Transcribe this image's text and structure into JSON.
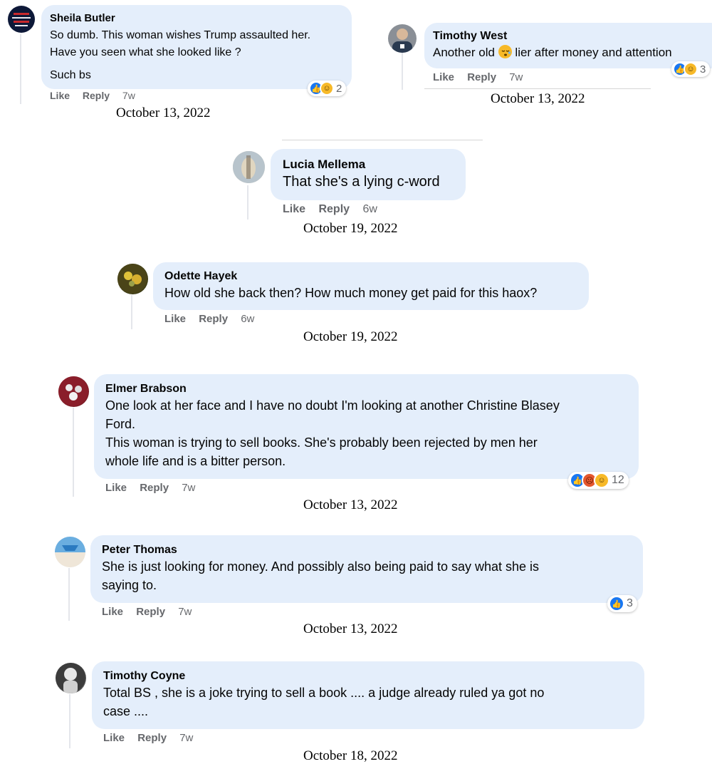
{
  "common": {
    "like_label": "Like",
    "reply_label": "Reply"
  },
  "comments": [
    {
      "author": "Sheila Butler",
      "lines": [
        "So dumb. This woman wishes Trump assaulted her.",
        "Have you seen what she looked like ?",
        "",
        "Such bs"
      ],
      "time": "7w",
      "reaction_count": "2",
      "date": "October 13, 2022"
    },
    {
      "author": "Timothy West",
      "text_before_emoji": "Another old ",
      "text_after_emoji": " lier after money and attention",
      "time": "7w",
      "reaction_count": "3",
      "date": "October 13, 2022"
    },
    {
      "author": "Lucia Mellema",
      "lines": [
        "That she's a lying c-word"
      ],
      "time": "6w",
      "date": "October 19, 2022"
    },
    {
      "author": "Odette Hayek",
      "lines": [
        "How old she back then? How much money get paid for this haox?"
      ],
      "time": "6w",
      "date": "October 19, 2022"
    },
    {
      "author": "Elmer Brabson",
      "lines": [
        "One look at her face and I have no doubt I'm looking at another Christine Blasey",
        "Ford.",
        "This woman is trying to sell books. She's probably been rejected by men her",
        "whole life and is a bitter person."
      ],
      "time": "7w",
      "reaction_count": "12",
      "date": "October 13, 2022"
    },
    {
      "author": "Peter Thomas",
      "lines": [
        "She is just looking for money. And possibly also being paid to say what she is",
        "saying to."
      ],
      "time": "7w",
      "reaction_count": "3",
      "date": "October 13, 2022"
    },
    {
      "author": "Timothy Coyne",
      "lines": [
        "Total BS , she is a joke trying to sell a book .... a judge already ruled ya got no",
        "case ...."
      ],
      "time": "7w",
      "date": "October 18, 2022"
    }
  ],
  "colors": {
    "bubble": "#e4eefb",
    "meta": "#65676b",
    "like": "#1877f2",
    "haha": "#f7b928",
    "angry": "#e4572e"
  },
  "icons": {
    "like": "like-reaction-icon",
    "haha": "haha-reaction-icon",
    "angry": "angry-reaction-icon",
    "emoji": "sleepy-face-emoji-icon"
  }
}
